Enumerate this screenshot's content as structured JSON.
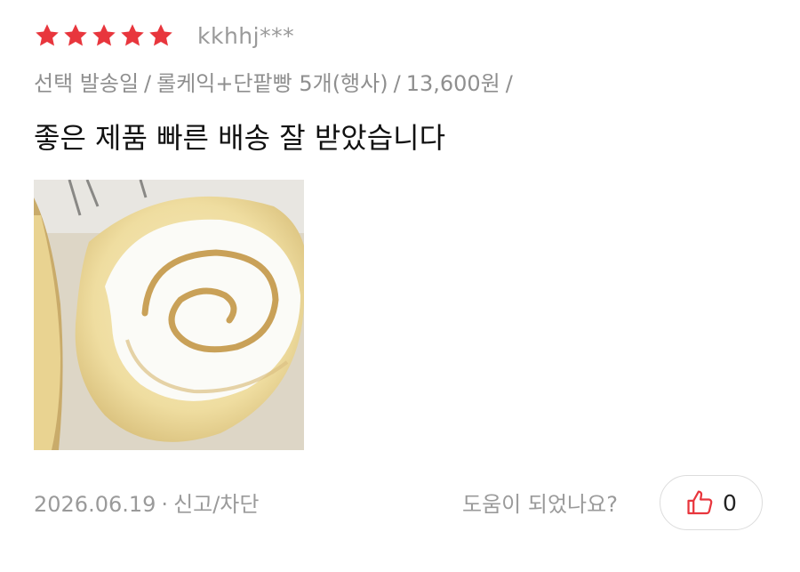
{
  "review": {
    "rating": 5,
    "max_rating": 5,
    "star_color": "#e8363d",
    "username": "kkhhj***",
    "options": {
      "field1": "선택 발송일",
      "separator": "/",
      "product": "롤케익+단팥빵 5개(행사)",
      "price": "13,600원"
    },
    "content": "좋은 제품 빠른 배송 잘 받았습니다",
    "photo": {
      "icon": "roll-cake-photo"
    },
    "date": "2026.06.19",
    "dot": "·",
    "report_label": "신고/차단",
    "helpful_question": "도움이 되었나요?",
    "like_count": "0",
    "like_icon": "thumbs-up-icon",
    "accent_color": "#e8363d"
  }
}
